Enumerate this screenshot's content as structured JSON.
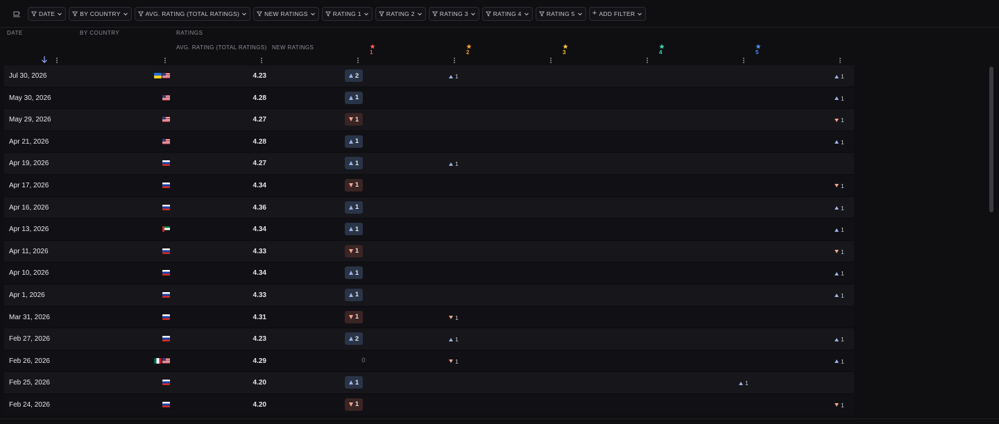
{
  "toolbar": {
    "chips": [
      {
        "label": "Date"
      },
      {
        "label": "By country"
      },
      {
        "label": "Avg. rating (total ratings)"
      },
      {
        "label": "New ratings"
      },
      {
        "label": "Rating 1"
      },
      {
        "label": "Rating 2"
      },
      {
        "label": "Rating 3"
      },
      {
        "label": "Rating 4"
      },
      {
        "label": "Rating 5"
      }
    ],
    "add_filter": "Add filter"
  },
  "table": {
    "group_headers": {
      "date": "Date",
      "country": "By country",
      "ratings": "Ratings"
    },
    "sub_headers": {
      "avg": "Avg. rating (total ratings)",
      "new": "New ratings"
    },
    "star_headers": [
      {
        "label": "1",
        "color": "#f25a5a"
      },
      {
        "label": "2",
        "color": "#f39a3a"
      },
      {
        "label": "3",
        "color": "#f2c230"
      },
      {
        "label": "4",
        "color": "#3ad6b0"
      },
      {
        "label": "5",
        "color": "#4a8ef5"
      }
    ],
    "rows": [
      {
        "date": "Jul 30, 2026",
        "flags": [
          "ua",
          "us"
        ],
        "avg": "4.23",
        "new": {
          "dir": "up",
          "val": "2"
        },
        "r1": null,
        "r2": {
          "dir": "up",
          "val": "1"
        },
        "r3": null,
        "r4": null,
        "r5": {
          "dir": "up",
          "val": "1"
        }
      },
      {
        "date": "May 30, 2026",
        "flags": [
          "us"
        ],
        "avg": "4.28",
        "new": {
          "dir": "up",
          "val": "1"
        },
        "r5": {
          "dir": "up",
          "val": "1"
        }
      },
      {
        "date": "May 29, 2026",
        "flags": [
          "us"
        ],
        "avg": "4.27",
        "new": {
          "dir": "down",
          "val": "1"
        },
        "r5": {
          "dir": "down",
          "val": "1"
        }
      },
      {
        "date": "Apr 21, 2026",
        "flags": [
          "us"
        ],
        "avg": "4.28",
        "new": {
          "dir": "up",
          "val": "1"
        },
        "r5": {
          "dir": "up",
          "val": "1"
        }
      },
      {
        "date": "Apr 19, 2026",
        "flags": [
          "ru"
        ],
        "avg": "4.27",
        "new": {
          "dir": "up",
          "val": "1"
        },
        "r2": {
          "dir": "up",
          "val": "1"
        }
      },
      {
        "date": "Apr 17, 2026",
        "flags": [
          "ru"
        ],
        "avg": "4.34",
        "new": {
          "dir": "down",
          "val": "1"
        },
        "r5": {
          "dir": "down",
          "val": "1"
        }
      },
      {
        "date": "Apr 16, 2026",
        "flags": [
          "ru"
        ],
        "avg": "4.36",
        "new": {
          "dir": "up",
          "val": "1"
        },
        "r5": {
          "dir": "up",
          "val": "1"
        }
      },
      {
        "date": "Apr 13, 2026",
        "flags": [
          "ae"
        ],
        "avg": "4.34",
        "new": {
          "dir": "up",
          "val": "1"
        },
        "r5": {
          "dir": "up",
          "val": "1"
        }
      },
      {
        "date": "Apr 11, 2026",
        "flags": [
          "ru"
        ],
        "avg": "4.33",
        "new": {
          "dir": "down",
          "val": "1"
        },
        "r5": {
          "dir": "down",
          "val": "1"
        }
      },
      {
        "date": "Apr 10, 2026",
        "flags": [
          "ru"
        ],
        "avg": "4.34",
        "new": {
          "dir": "up",
          "val": "1"
        },
        "r5": {
          "dir": "up",
          "val": "1"
        }
      },
      {
        "date": "Apr 1, 2026",
        "flags": [
          "ru"
        ],
        "avg": "4.33",
        "new": {
          "dir": "up",
          "val": "1"
        },
        "r5": {
          "dir": "up",
          "val": "1"
        }
      },
      {
        "date": "Mar 31, 2026",
        "flags": [
          "ru"
        ],
        "avg": "4.31",
        "new": {
          "dir": "down",
          "val": "1"
        },
        "r2": {
          "dir": "down",
          "val": "1"
        }
      },
      {
        "date": "Feb 27, 2026",
        "flags": [
          "ru"
        ],
        "avg": "4.23",
        "new": {
          "dir": "up",
          "val": "2"
        },
        "r2": {
          "dir": "up",
          "val": "1"
        },
        "r5": {
          "dir": "up",
          "val": "1"
        }
      },
      {
        "date": "Feb 26, 2026",
        "flags": [
          "mx",
          "us"
        ],
        "avg": "4.29",
        "new": {
          "dir": "zero",
          "val": "0"
        },
        "r2": {
          "dir": "down",
          "val": "1"
        },
        "r5": {
          "dir": "up",
          "val": "1"
        }
      },
      {
        "date": "Feb 25, 2026",
        "flags": [
          "ru"
        ],
        "avg": "4.20",
        "new": {
          "dir": "up",
          "val": "1"
        },
        "r4": {
          "dir": "up",
          "val": "1"
        }
      },
      {
        "date": "Feb 24, 2026",
        "flags": [
          "ru"
        ],
        "avg": "4.20",
        "new": {
          "dir": "down",
          "val": "1"
        },
        "r5": {
          "dir": "down",
          "val": "1"
        }
      }
    ]
  }
}
